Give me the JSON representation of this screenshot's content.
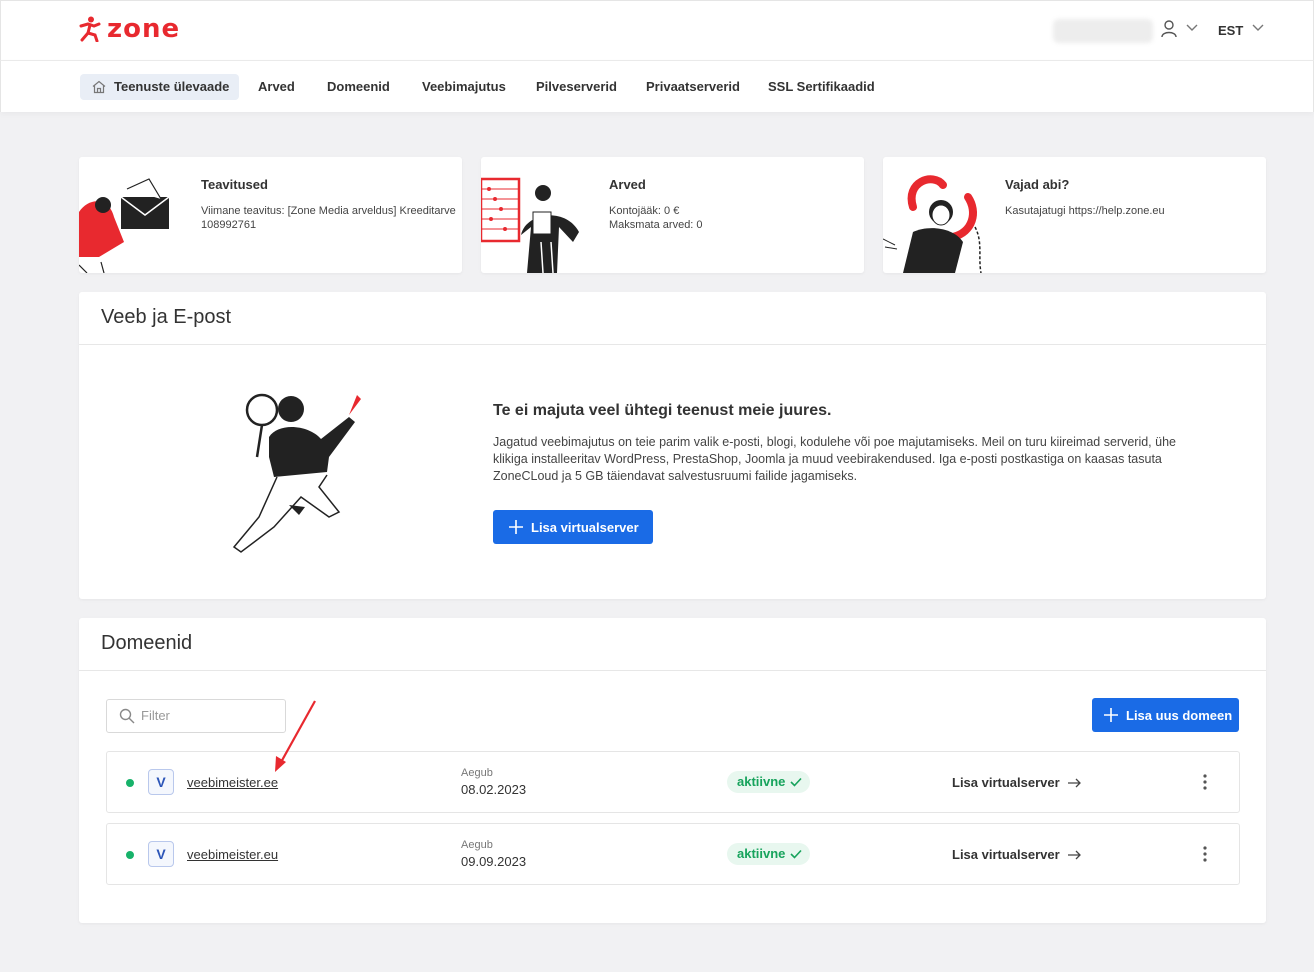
{
  "header": {
    "logo_text": "zone",
    "language": "EST",
    "brand_color": "#e8292f"
  },
  "nav": {
    "items": [
      {
        "label": "Teenuste ülevaade",
        "active": true
      },
      {
        "label": "Arved"
      },
      {
        "label": "Domeenid"
      },
      {
        "label": "Veebimajutus"
      },
      {
        "label": "Pilveserverid"
      },
      {
        "label": "Privaatserverid"
      },
      {
        "label": "SSL Sertifikaadid"
      }
    ]
  },
  "info_cards": {
    "notifications": {
      "title": "Teavitused",
      "text": "Viimane teavitus: [Zone Media arveldus] Kreeditarve 108992761"
    },
    "invoices": {
      "title": "Arved",
      "balance": "Kontojääk: 0 €",
      "unpaid": "Maksmata arved: 0"
    },
    "help": {
      "title": "Vajad abi?",
      "text": "Kasutajatugi https://help.zone.eu"
    }
  },
  "web_email": {
    "title": "Veeb ja E-post",
    "promo_title": "Te ei majuta veel ühtegi teenust meie juures.",
    "promo_desc": "Jagatud veebimajutus on teie parim valik e-posti, blogi, kodulehe või poe majutamiseks. Meil on turu kiireimad serverid, ühe klikiga installeeritav WordPress, PrestaShop, Joomla ja muud veebirakendused. Iga e-posti postkastiga on kaasas tasuta ZoneCLoud ja 5 GB täiendavat salvestusruumi failide jagamiseks.",
    "add_button": "Lisa virtualserver"
  },
  "domains": {
    "title": "Domeenid",
    "filter_placeholder": "Filter",
    "add_button": "Lisa uus domeen",
    "rows": [
      {
        "badge": "V",
        "name": "veebimeister.ee",
        "expires_label": "Aegub",
        "expires": "08.02.2023",
        "status": "aktiivne",
        "action": "Lisa virtualserver"
      },
      {
        "badge": "V",
        "name": "veebimeister.eu",
        "expires_label": "Aegub",
        "expires": "09.09.2023",
        "status": "aktiivne",
        "action": "Lisa virtualserver"
      }
    ]
  }
}
